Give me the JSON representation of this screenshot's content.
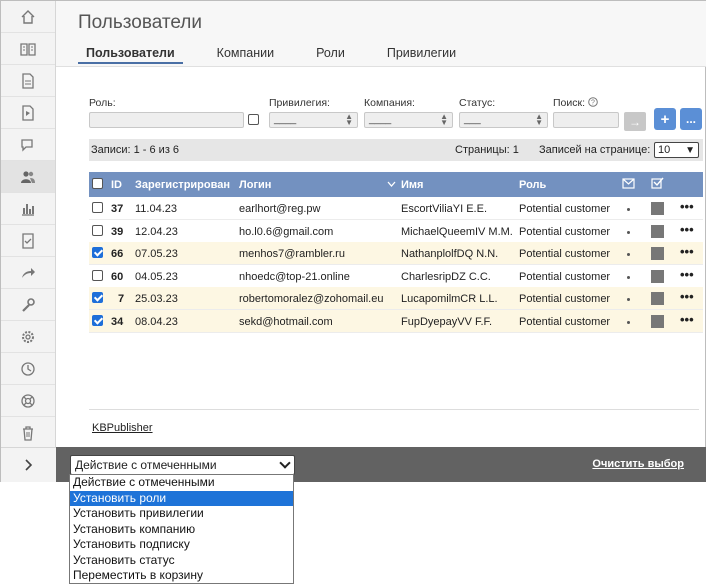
{
  "page": {
    "title": "Пользователи"
  },
  "tabs": [
    {
      "label": "Пользователи"
    },
    {
      "label": "Компании"
    },
    {
      "label": "Роли"
    },
    {
      "label": "Привилегии"
    }
  ],
  "sidebar_icons": [
    "home-icon",
    "book-icon",
    "document-icon",
    "pdf-icon",
    "comments-icon",
    "users-icon",
    "chart-icon",
    "file-check-icon",
    "share-icon",
    "wrench-icon",
    "gear-icon",
    "clock-icon",
    "lifebuoy-icon",
    "trash-icon"
  ],
  "filters": {
    "role_label": "Роль:",
    "privilege_label": "Привилегия:",
    "privilege_value": "____",
    "company_label": "Компания:",
    "company_value": "____",
    "status_label": "Статус:",
    "status_value": "___",
    "search_label": "Поиск:",
    "go_label": "→",
    "add_label": "+",
    "more_label": "..."
  },
  "info": {
    "records": "Записи: 1 - 6 из 6",
    "pages": "Страницы: 1",
    "per_page_label": "Записей на странице:",
    "per_page_value": "10"
  },
  "table": {
    "headers": {
      "id": "ID",
      "registered": "Зарегистрирован",
      "login": "Логин",
      "name": "Имя",
      "role": "Роль"
    },
    "rows": [
      {
        "checked": false,
        "id": "37",
        "date": "11.04.23",
        "login": "earlhort@reg.pw",
        "name": "EscortViliaYI E.E.",
        "role": "Potential customer"
      },
      {
        "checked": false,
        "id": "39",
        "date": "12.04.23",
        "login": "ho.l0.6@gmail.com",
        "name": "MichaelQueemIV M.M.",
        "role": "Potential customer"
      },
      {
        "checked": true,
        "id": "66",
        "date": "07.05.23",
        "login": "menhos7@rambler.ru",
        "name": "NathanplolfDQ N.N.",
        "role": "Potential customer"
      },
      {
        "checked": false,
        "id": "60",
        "date": "04.05.23",
        "login": "nhoedc@top-21.online",
        "name": "CharlesripDZ C.C.",
        "role": "Potential customer"
      },
      {
        "checked": true,
        "id": "7",
        "date": "25.03.23",
        "login": "robertomoralez@zohomail.eu",
        "name": "LucapomilmCR L.L.",
        "role": "Potential customer"
      },
      {
        "checked": true,
        "id": "34",
        "date": "08.04.23",
        "login": "sekd@hotmail.com",
        "name": "FupDyepayVV F.F.",
        "role": "Potential customer"
      }
    ],
    "row_menu": "•••"
  },
  "footer": {
    "link": "KBPublisher"
  },
  "actions": {
    "selected": "Действие с отмеченными",
    "clear": "Очистить выбор",
    "options": [
      "Действие с отмеченными",
      "Установить роли",
      "Установить привилегии",
      "Установить компанию",
      "Установить подписку",
      "Установить статус",
      "Переместить в корзину"
    ],
    "highlighted_index": 1
  },
  "colors": {
    "accent": "#5b8fd6",
    "table_header": "#7391c0",
    "selected_row": "#fdf7e3",
    "action_bar": "#626262",
    "highlight": "#1e73d8"
  }
}
